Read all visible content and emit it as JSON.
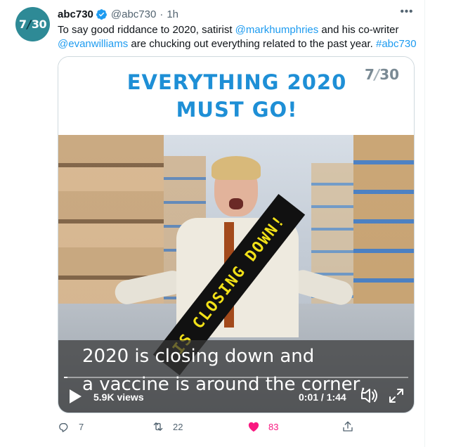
{
  "tweet": {
    "display_name": "abc730",
    "handle": "@abc730",
    "separator": "·",
    "time": "1h",
    "more_label": "•••",
    "avatar_text_left": "7",
    "avatar_text_sep": "/",
    "avatar_text_right": "30",
    "text": {
      "part1": "To say good riddance to 2020, satirist ",
      "mention1": "@markhumphries",
      "part2": " and his co-writer ",
      "mention2": "@evanwilliams",
      "part3": " are chucking out everything related to the past year. ",
      "hashtag": "#abc730"
    }
  },
  "media": {
    "banner_line1": "EVERYTHING 2020",
    "banner_line2": "MUST GO!",
    "banner_logo_left": "7",
    "banner_logo_sep": "/",
    "banner_logo_right": "30",
    "sash_text": "IS CLOSING DOWN!",
    "caption_line1": "2020 is closing down and",
    "caption_line2": "a vaccine is around the corner,",
    "views": "5.9K views",
    "timecode": "0:01 / 1:44",
    "progress_fraction": 0.01
  },
  "actions": {
    "reply_count": "7",
    "retweet_count": "22",
    "like_count": "83"
  },
  "colors": {
    "accent": "#1d9bf0",
    "like": "#f91880",
    "muted": "#536471",
    "banner_blue": "#1e8fd6",
    "sash_yellow": "#f2e118"
  },
  "icons": {
    "verified": "verified-badge-icon",
    "more": "more-horizontal-icon",
    "play": "play-icon",
    "volume": "volume-icon",
    "fullscreen": "fullscreen-icon",
    "reply": "reply-icon",
    "retweet": "retweet-icon",
    "like": "heart-icon",
    "share": "share-icon"
  }
}
